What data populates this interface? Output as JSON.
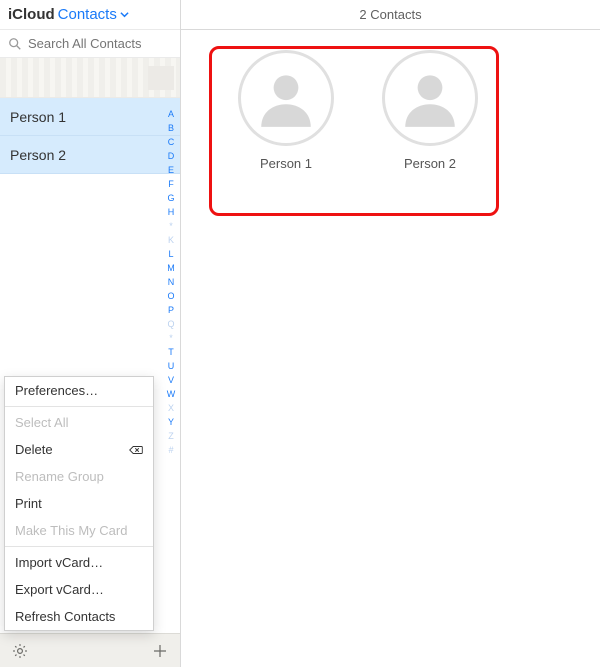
{
  "header": {
    "brand": "iCloud",
    "section": "Contacts"
  },
  "search": {
    "placeholder": "Search All Contacts"
  },
  "contacts_list": [
    {
      "name": "Person 1"
    },
    {
      "name": "Person 2"
    }
  ],
  "alpha_index": [
    "A",
    "B",
    "C",
    "D",
    "E",
    "F",
    "G",
    "H",
    "*",
    "K",
    "L",
    "M",
    "N",
    "O",
    "P",
    "Q",
    "*",
    "T",
    "U",
    "V",
    "W",
    "X",
    "Y",
    "Z",
    "#"
  ],
  "alpha_dim": [
    "*",
    "K",
    "Q",
    "X",
    "Z",
    "#"
  ],
  "menu": {
    "preferences": "Preferences…",
    "select_all": "Select All",
    "delete": "Delete",
    "rename_group": "Rename Group",
    "print": "Print",
    "make_card": "Make This My Card",
    "import_vcard": "Import vCard…",
    "export_vcard": "Export vCard…",
    "refresh": "Refresh Contacts"
  },
  "main": {
    "title": "2 Contacts",
    "cards": [
      {
        "label": "Person 1"
      },
      {
        "label": "Person 2"
      }
    ]
  },
  "colors": {
    "accent": "#1a7af8",
    "highlight_border": "#e11"
  }
}
